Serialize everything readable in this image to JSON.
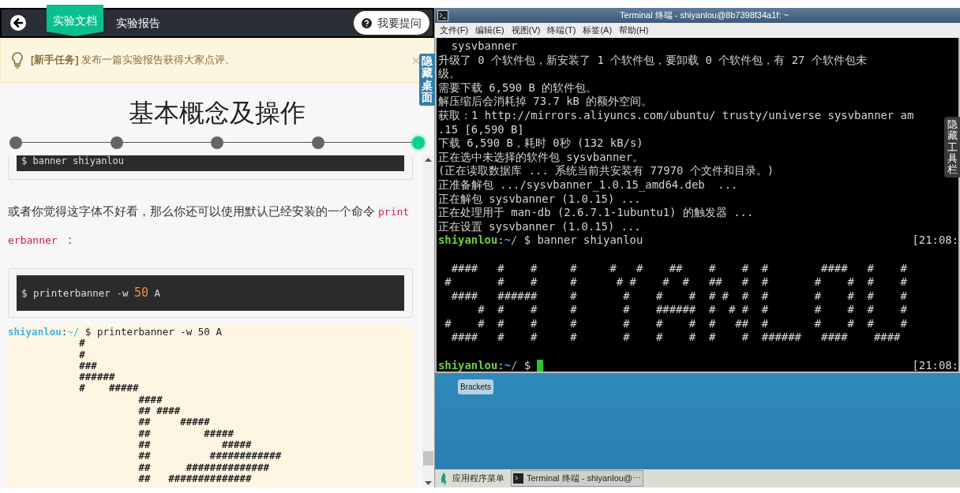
{
  "nav": {
    "tabs": [
      {
        "label": "实验文档",
        "selected": true
      },
      {
        "label": "实验报告",
        "selected": false
      }
    ],
    "ask_button": "我要提问"
  },
  "notice": {
    "tag": "[新手任务]",
    "text": "发布一篇实验报告获得大家点评。"
  },
  "hide_desktop_tab": "隐藏桌面",
  "doc": {
    "title": "基本概念及操作",
    "steps": [
      {
        "selected": false
      },
      {
        "selected": false
      },
      {
        "selected": false
      },
      {
        "selected": false
      },
      {
        "selected": true
      }
    ],
    "prev_code": "$ banner shiyanlou",
    "paragraph": {
      "text": "或者你觉得这字体不好看，那么你还可以使用默认已经安装的一个命令",
      "code": "printerbanner",
      "after": "："
    },
    "code": {
      "before": "$ printerbanner -w",
      "number": "50",
      "after": "A"
    },
    "output": {
      "user": "shiyanlou",
      "sep": ":",
      "path": "~/",
      "command": "$ printerbanner -w 50 A",
      "lines": [
        "            #",
        "            #",
        "            ###",
        "            ######",
        "            #    #####",
        "                      ####",
        "                      ## ####",
        "                      ##     #####",
        "                      ##         #####",
        "                      ##            #####",
        "                      ##          ############",
        "                      ##      ##############",
        "                      ##   ##############"
      ]
    }
  },
  "terminal": {
    "title": "Terminal 终端 - shiyanlou@8b7398f34a1f: ~",
    "menu": [
      "文件(F)",
      "编辑(E)",
      "视图(V)",
      "终端(T)",
      "标签(A)",
      "帮助(H)"
    ],
    "lines": [
      {
        "kind": "text",
        "text": "  sysvbanner"
      },
      {
        "kind": "text",
        "text": "升级了 0 个软件包，新安装了 1 个软件包，要卸载 0 个软件包，有 27 个软件包未"
      },
      {
        "kind": "text",
        "text": "级。"
      },
      {
        "kind": "text",
        "text": "需要下载 6,590 B 的软件包。"
      },
      {
        "kind": "text",
        "text": "解压缩后会消耗掉 73.7 kB 的额外空间。"
      },
      {
        "kind": "text",
        "text": "获取：1 http://mirrors.aliyuncs.com/ubuntu/ trusty/universe sysvbanner am"
      },
      {
        "kind": "text",
        "text": ".15 [6,590 B]"
      },
      {
        "kind": "text",
        "text": "下载 6,590 B，耗时 0秒 (132 kB/s)"
      },
      {
        "kind": "text",
        "text": "正在选中未选择的软件包 sysvbanner。"
      },
      {
        "kind": "text",
        "text": "(正在读取数据库 ... 系统当前共安装有 77970 个文件和目录。)"
      },
      {
        "kind": "text",
        "text": "正准备解包 .../sysvbanner_1.0.15_amd64.deb  ..."
      },
      {
        "kind": "text",
        "text": "正在解包 sysvbanner (1.0.15) ..."
      },
      {
        "kind": "text",
        "text": "正在处理用于 man-db (2.6.7.1-1ubuntu1) 的触发器 ..."
      },
      {
        "kind": "text",
        "text": "正在设置 sysvbanner (1.0.15) ..."
      },
      {
        "kind": "prompt",
        "user": "shiyanlou",
        "sep": ":",
        "path": "~/",
        "command": "$ banner shiyanlou",
        "time": "[21:08:"
      },
      {
        "kind": "blank"
      },
      {
        "kind": "art",
        "text": "  ####   #    #     #     #   #    ##    #    #  #        ####   #    #"
      },
      {
        "kind": "art",
        "text": " #       #    #     #      # #    #  #   ##   #  #       #    #  #    #"
      },
      {
        "kind": "art",
        "text": "  ####   ######     #       #    #    #  # #  #  #       #    #  #    #"
      },
      {
        "kind": "art",
        "text": "      #  #    #     #       #    ######  #  # #  #       #    #  #    #"
      },
      {
        "kind": "art",
        "text": " #    #  #    #     #       #    #    #  #   ##  #       #    #  #    #"
      },
      {
        "kind": "art",
        "text": "  ####   #    #     #       #    #    #  #    #  ######   ####    ####"
      },
      {
        "kind": "blank"
      },
      {
        "kind": "prompt",
        "user": "shiyanlou",
        "sep": ":",
        "path": "~/",
        "command": "$",
        "cursor": true,
        "time": "[21:08:"
      }
    ]
  },
  "hide_toolbar_tab": "隐藏工具栏",
  "desktop": {
    "icon_label": "Brackets"
  },
  "taskbar": {
    "menu": "应用程序菜单",
    "task": "Terminal 终端 - shiyanlou@⋯"
  }
}
